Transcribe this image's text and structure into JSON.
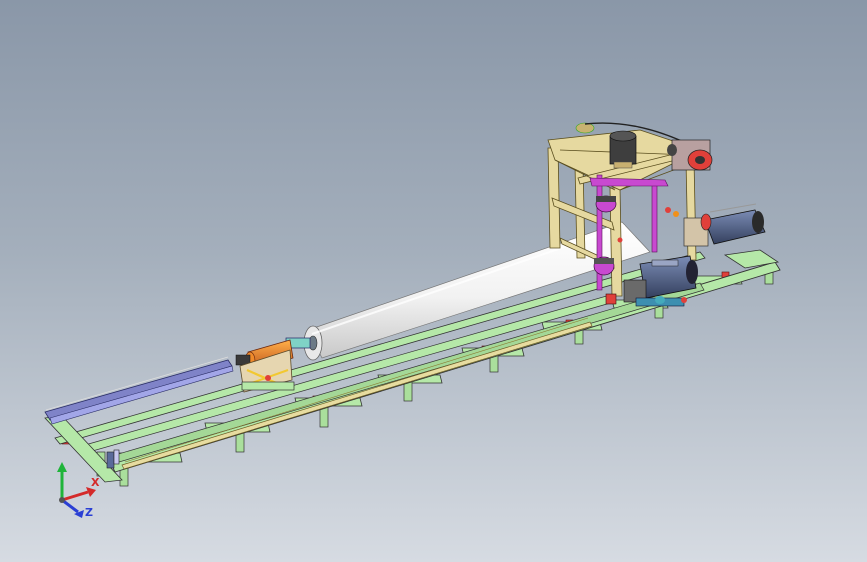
{
  "viewport": {
    "background_top": "#8a97a8",
    "background_bottom": "#d6dbe2"
  },
  "triad": {
    "x_label": "X",
    "z_label": "Z",
    "x_color": "#d42a2a",
    "y_color": "#1fb43a",
    "z_color": "#2a3fd4"
  },
  "model": {
    "frame_color": "#b5e8a8",
    "rail_color": "#d6c98c",
    "cylinder_color": "#f6f6f6",
    "accent_colors": [
      "#e0403a",
      "#c849d0",
      "#5a6a9a",
      "#f0901a",
      "#3a3a3a"
    ]
  }
}
